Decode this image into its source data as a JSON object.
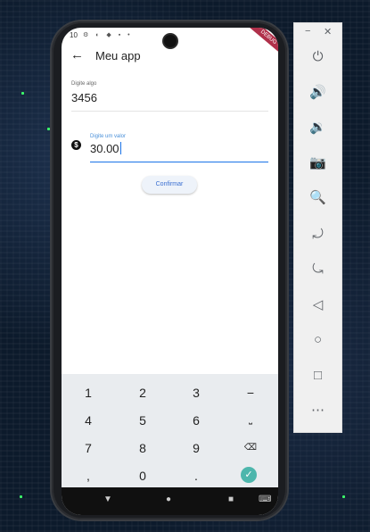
{
  "status": {
    "time": "10",
    "icons": "⚙ ◐ ◆ ▪ •"
  },
  "app": {
    "title": "Meu app",
    "debug_banner": "DEBUG"
  },
  "form": {
    "field1": {
      "label": "Digite algo",
      "value": "3456"
    },
    "field2": {
      "label": "Digite um valor",
      "value": "30.00"
    },
    "confirm_label": "Confirmar"
  },
  "keyboard": {
    "rows": [
      [
        "1",
        "2",
        "3",
        "−"
      ],
      [
        "4",
        "5",
        "6",
        "⎵"
      ],
      [
        "7",
        "8",
        "9",
        "⌫"
      ],
      [
        ",",
        "0",
        ".",
        "✓"
      ]
    ]
  },
  "navbar": {
    "back": "▼",
    "home": "●",
    "recents": "■",
    "keyboard": "⌨"
  },
  "emulator_panel": {
    "minimize": "−",
    "close": "✕",
    "buttons": [
      "⏻",
      "🔊",
      "🔉",
      "📷",
      "🔍",
      "⤾",
      "⤿",
      "◁",
      "○",
      "□",
      "⋯"
    ]
  },
  "colors": {
    "accent": "#1a73e8",
    "done_key": "#4db6ac"
  }
}
